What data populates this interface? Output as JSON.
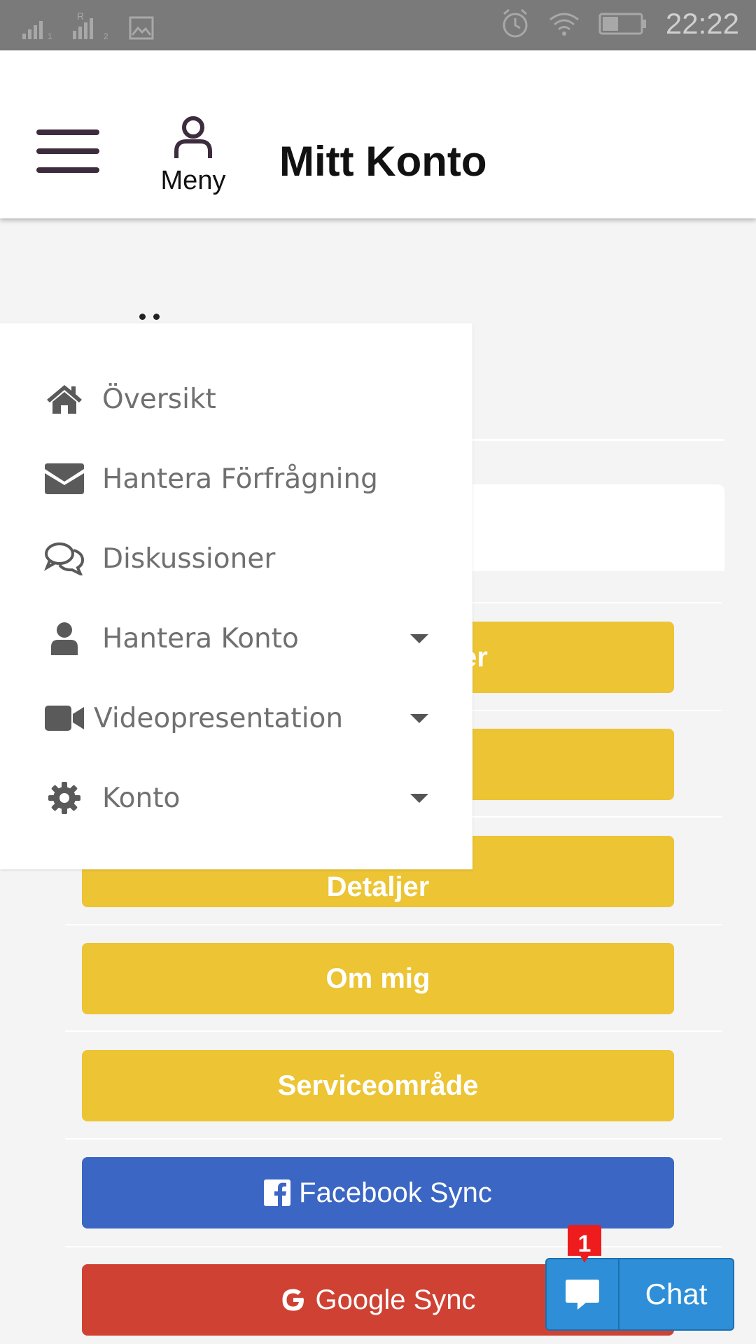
{
  "status_bar": {
    "time": "22:22",
    "icons": [
      "signal-1-icon",
      "signal-2-icon",
      "image-icon",
      "alarm-icon",
      "wifi-icon",
      "battery-icon"
    ]
  },
  "header": {
    "hamburger_icon": "hamburger-icon",
    "menu_label": "Meny",
    "title": "Mitt Konto"
  },
  "side_menu": {
    "items": [
      {
        "label": "Översikt",
        "icon": "home-icon",
        "has_caret": false
      },
      {
        "label": "Hantera Förfrågning",
        "icon": "envelope-icon",
        "has_caret": false
      },
      {
        "label": "Diskussioner",
        "icon": "comments-icon",
        "has_caret": false
      },
      {
        "label": "Hantera Konto",
        "icon": "user-icon",
        "has_caret": true
      },
      {
        "label": "Videopresentation",
        "icon": "video-icon",
        "has_caret": true
      },
      {
        "label": "Konto",
        "icon": "gear-icon",
        "has_caret": true
      }
    ]
  },
  "buttons": {
    "btn1_label_visible": "er",
    "btn3_label": "Detaljer",
    "btn4_label": "Om mig",
    "btn5_label": "Serviceområde",
    "facebook_label": "Facebook Sync",
    "google_label": "Google Sync"
  },
  "chat": {
    "label": "Chat",
    "badge": "1"
  },
  "colors": {
    "accent_yellow": "#ecc434",
    "facebook_blue": "#3b66c4",
    "google_red": "#cf4233",
    "chat_blue": "#2e8fd8",
    "badge_red": "#ee1c1c",
    "hamburger": "#3d2c3d"
  }
}
